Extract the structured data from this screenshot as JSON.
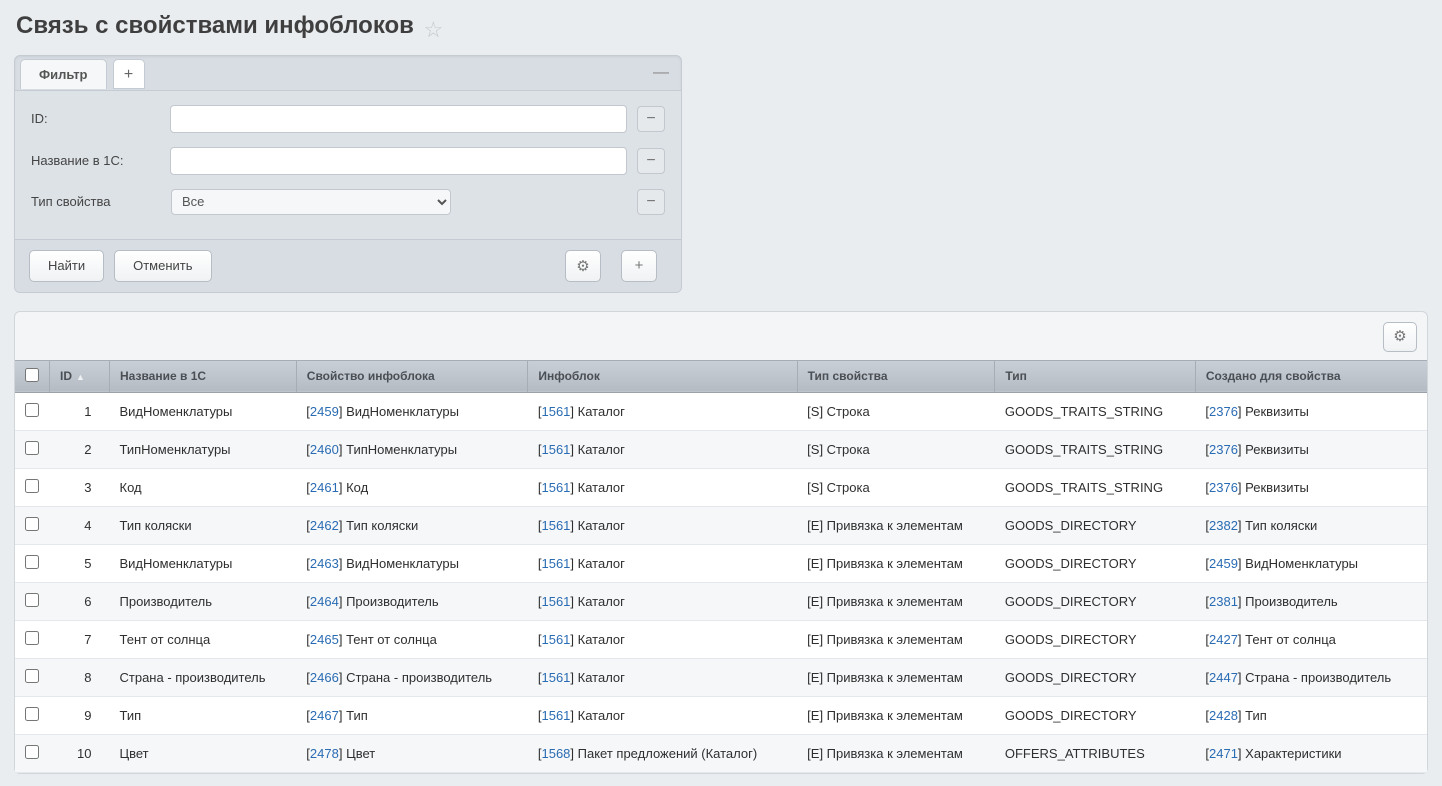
{
  "page": {
    "title": "Связь с свойствами инфоблоков"
  },
  "filter": {
    "tab_label": "Фильтр",
    "rows": {
      "id_label": "ID:",
      "name_label": "Название в 1С:",
      "type_label": "Тип свойства",
      "type_value": "Все"
    },
    "buttons": {
      "find": "Найти",
      "cancel": "Отменить"
    }
  },
  "grid": {
    "columns": {
      "id": "ID",
      "name1c": "Название в 1С",
      "prop": "Свойство инфоблока",
      "iblock": "Инфоблок",
      "ptype": "Тип свойства",
      "type": "Тип",
      "created": "Создано для свойства"
    },
    "rows": [
      {
        "id": "1",
        "name1c": "ВидНоменклатуры",
        "prop_id": "2459",
        "prop_name": "ВидНоменклатуры",
        "iblock_id": "1561",
        "iblock_name": "Каталог",
        "ptype": "[S] Строка",
        "type": "GOODS_TRAITS_STRING",
        "created_id": "2376",
        "created_name": "Реквизиты"
      },
      {
        "id": "2",
        "name1c": "ТипНоменклатуры",
        "prop_id": "2460",
        "prop_name": "ТипНоменклатуры",
        "iblock_id": "1561",
        "iblock_name": "Каталог",
        "ptype": "[S] Строка",
        "type": "GOODS_TRAITS_STRING",
        "created_id": "2376",
        "created_name": "Реквизиты"
      },
      {
        "id": "3",
        "name1c": "Код",
        "prop_id": "2461",
        "prop_name": "Код",
        "iblock_id": "1561",
        "iblock_name": "Каталог",
        "ptype": "[S] Строка",
        "type": "GOODS_TRAITS_STRING",
        "created_id": "2376",
        "created_name": "Реквизиты"
      },
      {
        "id": "4",
        "name1c": "Тип коляски",
        "prop_id": "2462",
        "prop_name": "Тип коляски",
        "iblock_id": "1561",
        "iblock_name": "Каталог",
        "ptype": "[E] Привязка к элементам",
        "type": "GOODS_DIRECTORY",
        "created_id": "2382",
        "created_name": "Тип коляски"
      },
      {
        "id": "5",
        "name1c": "ВидНоменклатуры",
        "prop_id": "2463",
        "prop_name": "ВидНоменклатуры",
        "iblock_id": "1561",
        "iblock_name": "Каталог",
        "ptype": "[E] Привязка к элементам",
        "type": "GOODS_DIRECTORY",
        "created_id": "2459",
        "created_name": "ВидНоменклатуры"
      },
      {
        "id": "6",
        "name1c": "Производитель",
        "prop_id": "2464",
        "prop_name": "Производитель",
        "iblock_id": "1561",
        "iblock_name": "Каталог",
        "ptype": "[E] Привязка к элементам",
        "type": "GOODS_DIRECTORY",
        "created_id": "2381",
        "created_name": "Производитель"
      },
      {
        "id": "7",
        "name1c": "Тент от солнца",
        "prop_id": "2465",
        "prop_name": "Тент от солнца",
        "iblock_id": "1561",
        "iblock_name": "Каталог",
        "ptype": "[E] Привязка к элементам",
        "type": "GOODS_DIRECTORY",
        "created_id": "2427",
        "created_name": "Тент от солнца"
      },
      {
        "id": "8",
        "name1c": "Страна - производитель",
        "prop_id": "2466",
        "prop_name": "Страна - производитель",
        "iblock_id": "1561",
        "iblock_name": "Каталог",
        "ptype": "[E] Привязка к элементам",
        "type": "GOODS_DIRECTORY",
        "created_id": "2447",
        "created_name": "Страна - производитель"
      },
      {
        "id": "9",
        "name1c": "Тип",
        "prop_id": "2467",
        "prop_name": "Тип",
        "iblock_id": "1561",
        "iblock_name": "Каталог",
        "ptype": "[E] Привязка к элементам",
        "type": "GOODS_DIRECTORY",
        "created_id": "2428",
        "created_name": "Тип"
      },
      {
        "id": "10",
        "name1c": "Цвет",
        "prop_id": "2478",
        "prop_name": "Цвет",
        "iblock_id": "1568",
        "iblock_name": "Пакет предложений (Каталог)",
        "ptype": "[E] Привязка к элементам",
        "type": "OFFERS_ATTRIBUTES",
        "created_id": "2471",
        "created_name": "Характеристики"
      }
    ]
  }
}
